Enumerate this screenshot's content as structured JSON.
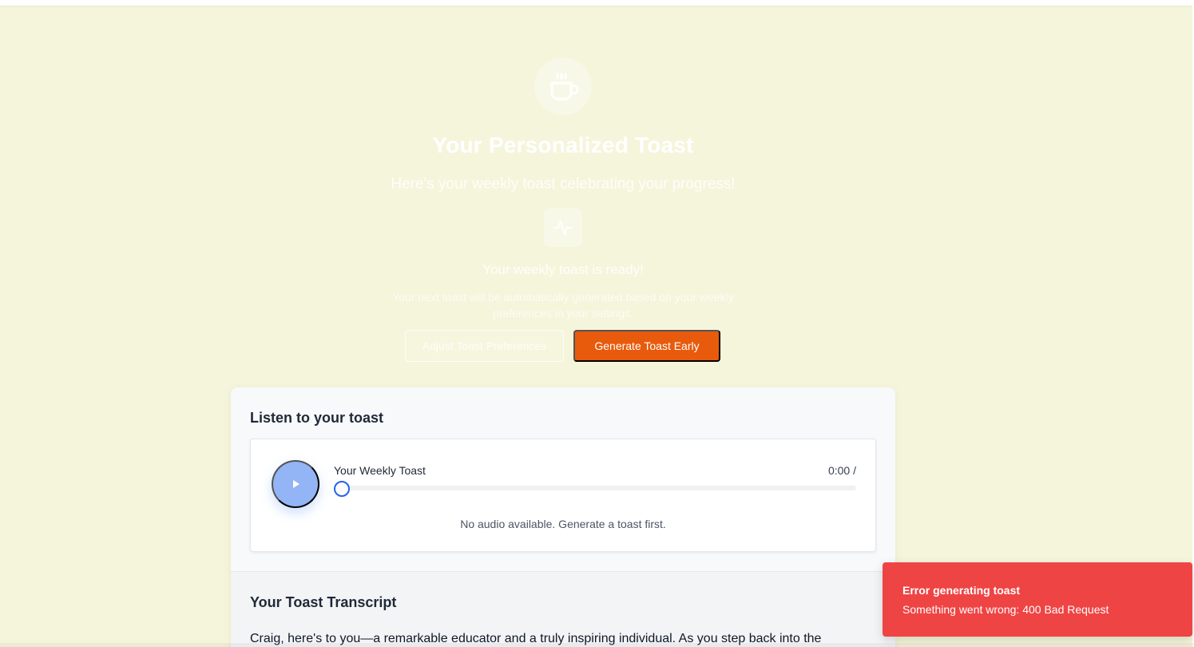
{
  "hero": {
    "icon": "coffee-cup-icon",
    "title": "Your Personalized Toast",
    "subtitle": "Here's your weekly toast celebrating your progress!",
    "status_icon": "activity-pulse-icon",
    "ready_text": "Your weekly toast is ready!",
    "next_text": "Your next toast will be automatically generated based on your weekly preferences in your settings.",
    "adjust_label": "Adjust Toast Preferences",
    "generate_label": "Generate Toast Early"
  },
  "listen": {
    "heading": "Listen to your toast",
    "player": {
      "title": "Your Weekly Toast",
      "time": "0:00 /",
      "progress": 0,
      "no_audio": "No audio available. Generate a toast first."
    }
  },
  "transcript": {
    "heading": "Your Toast Transcript",
    "text": "Craig, here's to you—a remarkable educator and a truly inspiring individual. As you step back into the"
  },
  "toast_notification": {
    "title": "Error generating toast",
    "message": "Something went wrong: 400 Bad Request"
  },
  "colors": {
    "background": "#f5f5dc",
    "accent": "#e85a0c",
    "error": "#ef4444",
    "play_button": "#93b4f5"
  }
}
